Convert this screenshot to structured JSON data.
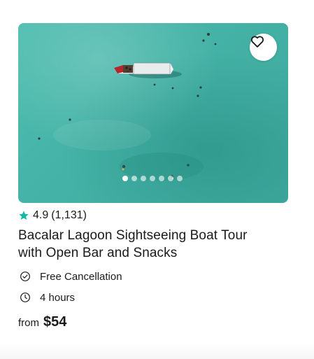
{
  "card": {
    "image": {
      "alt_icon": "boat-on-lagoon",
      "carousel_total": 7,
      "carousel_active": 1
    },
    "favorite": {
      "icon": "heart-icon"
    },
    "rating": {
      "score": "4.9",
      "count": "(1,131)",
      "star_color": "#14b8a6"
    },
    "title": "Bacalar Lagoon Sightseeing Boat Tour with Open Bar and Snacks",
    "features": [
      {
        "icon": "check-circle-icon",
        "label": "Free Cancellation"
      },
      {
        "icon": "clock-icon",
        "label": "4 hours"
      }
    ],
    "price": {
      "prefix": "from",
      "amount": "$54"
    }
  }
}
